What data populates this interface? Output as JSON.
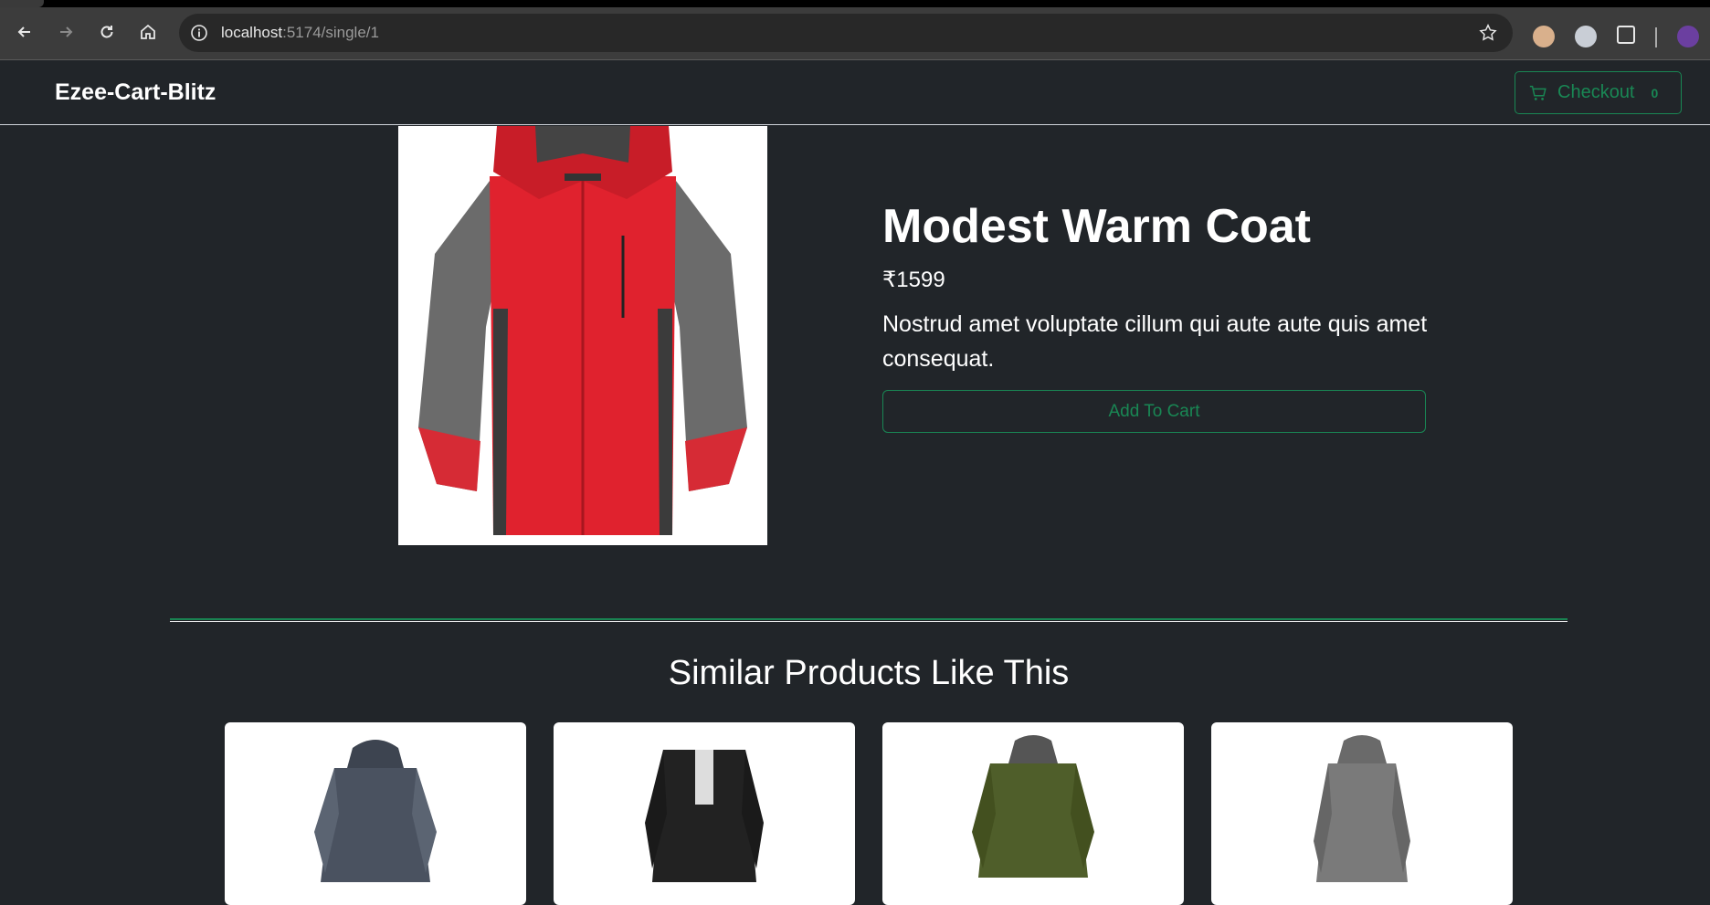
{
  "browser": {
    "url_host": "localhost",
    "url_path": ":5174/single/1"
  },
  "navbar": {
    "brand": "Ezee-Cart-Blitz",
    "checkout_label": "Checkout",
    "cart_count": "0"
  },
  "product": {
    "title": "Modest Warm Coat",
    "price": "₹1599",
    "description": "Nostrud amet voluptate cillum qui aute aute quis amet consequat.",
    "add_to_cart_label": "Add To Cart"
  },
  "similar": {
    "heading": "Similar Products Like This"
  },
  "colors": {
    "accent": "#198754",
    "background": "#212529"
  }
}
